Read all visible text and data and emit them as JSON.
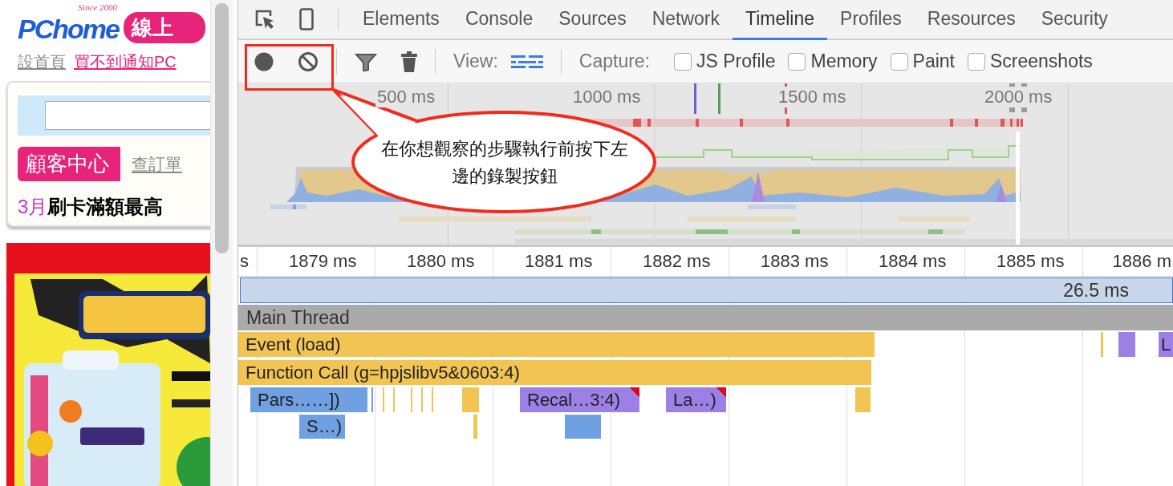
{
  "webpage": {
    "logo": "PChome",
    "logo_tagline": "Since 2000",
    "logo_badge": "線上",
    "links": [
      {
        "text": "設首頁",
        "kind": "plain"
      },
      {
        "text": "買不到通知PC",
        "kind": "promo"
      }
    ],
    "customer_center": {
      "title": "顧客中心",
      "link": "查訂單"
    },
    "promo": {
      "month": "3月",
      "text": "刷卡滿額最高"
    }
  },
  "devtools": {
    "tabs": [
      {
        "label": "Elements",
        "selected": false
      },
      {
        "label": "Console",
        "selected": false
      },
      {
        "label": "Sources",
        "selected": false
      },
      {
        "label": "Network",
        "selected": false
      },
      {
        "label": "Timeline",
        "selected": true
      },
      {
        "label": "Profiles",
        "selected": false
      },
      {
        "label": "Resources",
        "selected": false
      },
      {
        "label": "Security",
        "selected": false
      }
    ],
    "toolbar": {
      "view_label": "View:",
      "capture_label": "Capture:",
      "capture_options": [
        {
          "label": "JS Profile",
          "checked": false
        },
        {
          "label": "Memory",
          "checked": false
        },
        {
          "label": "Paint",
          "checked": false
        },
        {
          "label": "Screenshots",
          "checked": false
        }
      ]
    },
    "overview": {
      "ticks": [
        "500 ms",
        "1000 ms",
        "1500 ms",
        "2000 ms"
      ]
    },
    "ruler": {
      "ticks": [
        "s",
        "1879 ms",
        "1880 ms",
        "1881 ms",
        "1882 ms",
        "1883 ms",
        "1884 ms",
        "1885 ms",
        "1886 m"
      ]
    },
    "selection": {
      "duration": "26.5 ms"
    },
    "thread": {
      "name": "Main Thread"
    },
    "events": [
      {
        "label": "Event (load)",
        "kind": "scripting",
        "warning": false
      },
      {
        "label": "Function Call (g=hpjslibv5&0603:4)",
        "kind": "scripting",
        "warning": false
      },
      {
        "label": "Pars……])",
        "kind": "loading",
        "warning": false
      },
      {
        "label": "Recal…3:4)",
        "kind": "rendering",
        "warning": true
      },
      {
        "label": "La…)",
        "kind": "rendering",
        "warning": true
      },
      {
        "label": "S…)",
        "kind": "loading",
        "warning": false
      },
      {
        "label": "L",
        "kind": "rendering",
        "warning": false
      }
    ]
  },
  "callout": {
    "text": "在你想觀察的步驟執行前按下左邊的錄製按鈕"
  }
}
